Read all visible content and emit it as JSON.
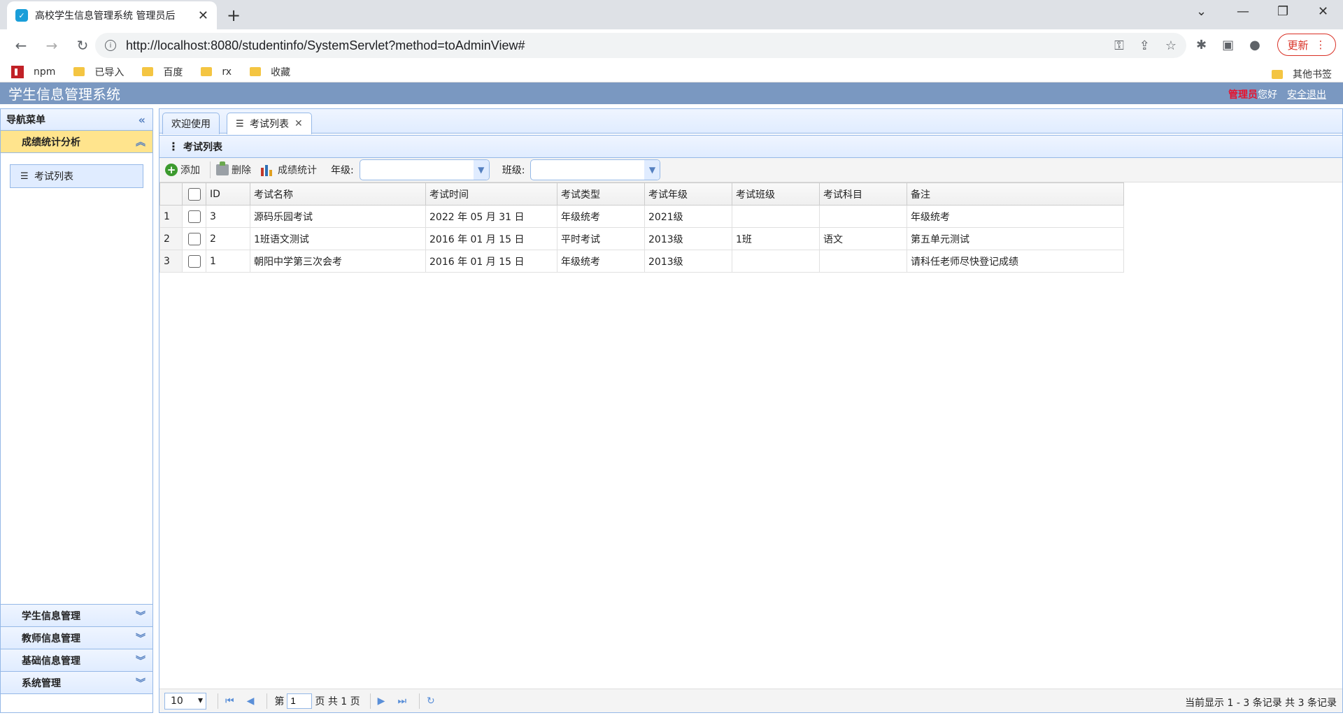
{
  "browser": {
    "tab_title": "高校学生信息管理系统 管理员后",
    "url": "http://localhost:8080/studentinfo/SystemServlet?method=toAdminView#",
    "update_label": "更新",
    "bookmarks": [
      "npm",
      "已导入",
      "百度",
      "rx",
      "收藏"
    ],
    "other_bookmarks": "其他书签"
  },
  "app": {
    "title": "学生信息管理系统",
    "role": "管理员",
    "greeting": "您好",
    "logout": "安全退出"
  },
  "nav": {
    "title": "导航菜单",
    "active_section": "成绩统计分析",
    "active_items": [
      "考试列表"
    ],
    "sections": [
      "学生信息管理",
      "教师信息管理",
      "基础信息管理",
      "系统管理"
    ]
  },
  "tabs": [
    {
      "label": "欢迎使用"
    },
    {
      "label": "考试列表"
    }
  ],
  "panel": {
    "title": "考试列表",
    "add": "添加",
    "delete": "删除",
    "stats": "成绩统计",
    "grade_label": "年级:",
    "class_label": "班级:"
  },
  "table": {
    "columns": [
      "ID",
      "考试名称",
      "考试时间",
      "考试类型",
      "考试年级",
      "考试班级",
      "考试科目",
      "备注"
    ],
    "rows": [
      {
        "num": "1",
        "id": "3",
        "name": "源码乐园考试",
        "time": "2022 年 05 月 31 日",
        "type": "年级统考",
        "grade": "2021级",
        "class": "",
        "subject": "",
        "remark": "年级统考"
      },
      {
        "num": "2",
        "id": "2",
        "name": "1班语文测试",
        "time": "2016 年 01 月 15 日",
        "type": "平时考试",
        "grade": "2013级",
        "class": "1班",
        "subject": "语文",
        "remark": "第五单元测试"
      },
      {
        "num": "3",
        "id": "1",
        "name": "朝阳中学第三次会考",
        "time": "2016 年 01 月 15 日",
        "type": "年级统考",
        "grade": "2013级",
        "class": "",
        "subject": "",
        "remark": "请科任老师尽快登记成绩"
      }
    ]
  },
  "pager": {
    "page_size": "10",
    "page_prefix": "第",
    "page_value": "1",
    "page_suffix": "页 共 1 页",
    "info": "当前显示 1 - 3 条记录 共 3 条记录"
  }
}
